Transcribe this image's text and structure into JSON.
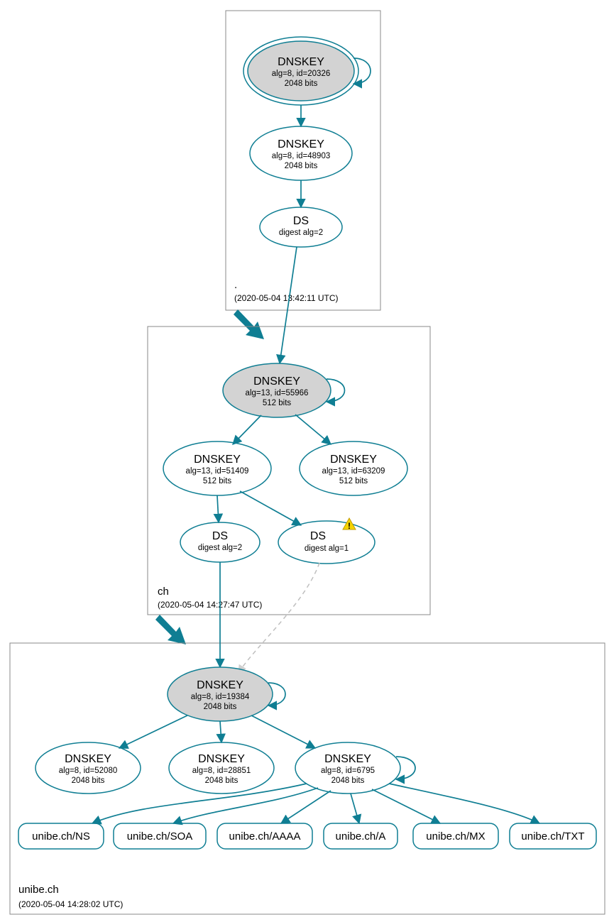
{
  "zones": {
    "root": {
      "label": ".",
      "timestamp": "(2020-05-04 13:42:11 UTC)"
    },
    "ch": {
      "label": "ch",
      "timestamp": "(2020-05-04 14:27:47 UTC)"
    },
    "leaf": {
      "label": "unibe.ch",
      "timestamp": "(2020-05-04 14:28:02 UTC)"
    }
  },
  "nodes": {
    "root_ksk": {
      "title": "DNSKEY",
      "line2": "alg=8, id=20326",
      "line3": "2048 bits"
    },
    "root_zsk": {
      "title": "DNSKEY",
      "line2": "alg=8, id=48903",
      "line3": "2048 bits"
    },
    "root_ds": {
      "title": "DS",
      "line2": "digest alg=2"
    },
    "ch_ksk": {
      "title": "DNSKEY",
      "line2": "alg=13, id=55966",
      "line3": "512 bits"
    },
    "ch_zsk1": {
      "title": "DNSKEY",
      "line2": "alg=13, id=51409",
      "line3": "512 bits"
    },
    "ch_zsk2": {
      "title": "DNSKEY",
      "line2": "alg=13, id=63209",
      "line3": "512 bits"
    },
    "ch_ds1": {
      "title": "DS",
      "line2": "digest alg=2"
    },
    "ch_ds2": {
      "title": "DS",
      "line2": "digest alg=1"
    },
    "leaf_ksk": {
      "title": "DNSKEY",
      "line2": "alg=8, id=19384",
      "line3": "2048 bits"
    },
    "leaf_k1": {
      "title": "DNSKEY",
      "line2": "alg=8, id=52080",
      "line3": "2048 bits"
    },
    "leaf_k2": {
      "title": "DNSKEY",
      "line2": "alg=8, id=28851",
      "line3": "2048 bits"
    },
    "leaf_k3": {
      "title": "DNSKEY",
      "line2": "alg=8, id=6795",
      "line3": "2048 bits"
    }
  },
  "rr": {
    "ns": "unibe.ch/NS",
    "soa": "unibe.ch/SOA",
    "aaaa": "unibe.ch/AAAA",
    "a": "unibe.ch/A",
    "mx": "unibe.ch/MX",
    "txt": "unibe.ch/TXT"
  },
  "colors": {
    "stroke": "#0f7e93"
  }
}
